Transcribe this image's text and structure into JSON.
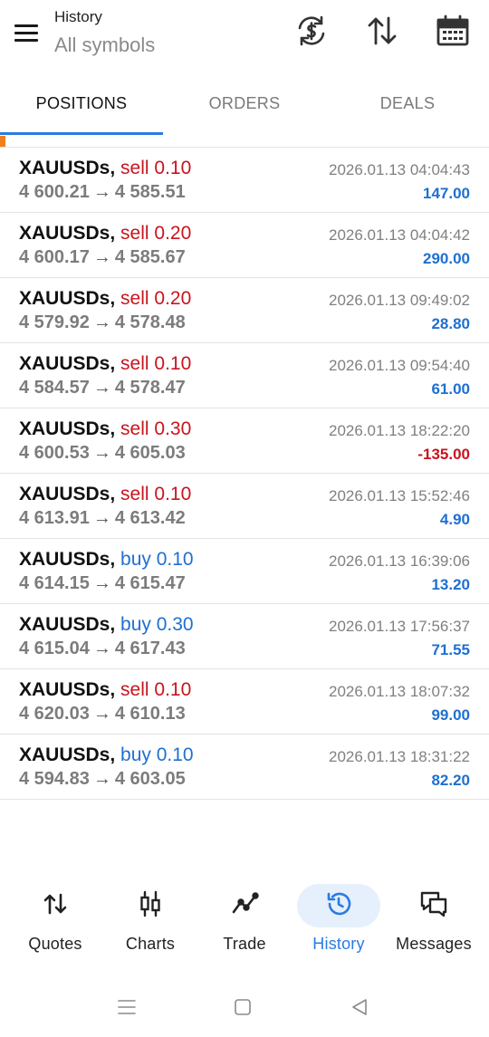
{
  "header": {
    "title": "History",
    "subtitle": "All symbols",
    "icons": [
      "currency-exchange-icon",
      "sort-icon",
      "calendar-icon"
    ]
  },
  "tabs": [
    {
      "label": "POSITIONS",
      "active": true
    },
    {
      "label": "ORDERS",
      "active": false
    },
    {
      "label": "DEALS",
      "active": false
    }
  ],
  "positions": [
    {
      "symbol": "XAUUSDs,",
      "side": "sell 0.10",
      "type": "sell",
      "open": "4 600.21",
      "close": "4 585.51",
      "time": "2026.01.13 04:04:43",
      "profit": "147.00"
    },
    {
      "symbol": "XAUUSDs,",
      "side": "sell 0.20",
      "type": "sell",
      "open": "4 600.17",
      "close": "4 585.67",
      "time": "2026.01.13 04:04:42",
      "profit": "290.00"
    },
    {
      "symbol": "XAUUSDs,",
      "side": "sell 0.20",
      "type": "sell",
      "open": "4 579.92",
      "close": "4 578.48",
      "time": "2026.01.13 09:49:02",
      "profit": "28.80"
    },
    {
      "symbol": "XAUUSDs,",
      "side": "sell 0.10",
      "type": "sell",
      "open": "4 584.57",
      "close": "4 578.47",
      "time": "2026.01.13 09:54:40",
      "profit": "61.00"
    },
    {
      "symbol": "XAUUSDs,",
      "side": "sell 0.30",
      "type": "sell",
      "open": "4 600.53",
      "close": "4 605.03",
      "time": "2026.01.13 18:22:20",
      "profit": "-135.00"
    },
    {
      "symbol": "XAUUSDs,",
      "side": "sell 0.10",
      "type": "sell",
      "open": "4 613.91",
      "close": "4 613.42",
      "time": "2026.01.13 15:52:46",
      "profit": "4.90"
    },
    {
      "symbol": "XAUUSDs,",
      "side": "buy 0.10",
      "type": "buy",
      "open": "4 614.15",
      "close": "4 615.47",
      "time": "2026.01.13 16:39:06",
      "profit": "13.20"
    },
    {
      "symbol": "XAUUSDs,",
      "side": "buy 0.30",
      "type": "buy",
      "open": "4 615.04",
      "close": "4 617.43",
      "time": "2026.01.13 17:56:37",
      "profit": "71.55"
    },
    {
      "symbol": "XAUUSDs,",
      "side": "sell 0.10",
      "type": "sell",
      "open": "4 620.03",
      "close": "4 610.13",
      "time": "2026.01.13 18:07:32",
      "profit": "99.00"
    },
    {
      "symbol": "XAUUSDs,",
      "side": "buy 0.10",
      "type": "buy",
      "open": "4 594.83",
      "close": "4 603.05",
      "time": "2026.01.13 18:31:22",
      "profit": "82.20"
    }
  ],
  "arrow": "→",
  "bottom_nav": [
    {
      "label": "Quotes",
      "icon": "quotes-icon",
      "active": false
    },
    {
      "label": "Charts",
      "icon": "charts-icon",
      "active": false
    },
    {
      "label": "Trade",
      "icon": "trade-icon",
      "active": false
    },
    {
      "label": "History",
      "icon": "history-icon",
      "active": true
    },
    {
      "label": "Messages",
      "icon": "messages-icon",
      "active": false
    }
  ],
  "colors": {
    "accent": "#2a7be4",
    "sell": "#c8141e",
    "buy": "#1f6fd1",
    "loss": "#c8141e",
    "active_pill": "#e6f0fc",
    "marker": "#f07f1d"
  }
}
